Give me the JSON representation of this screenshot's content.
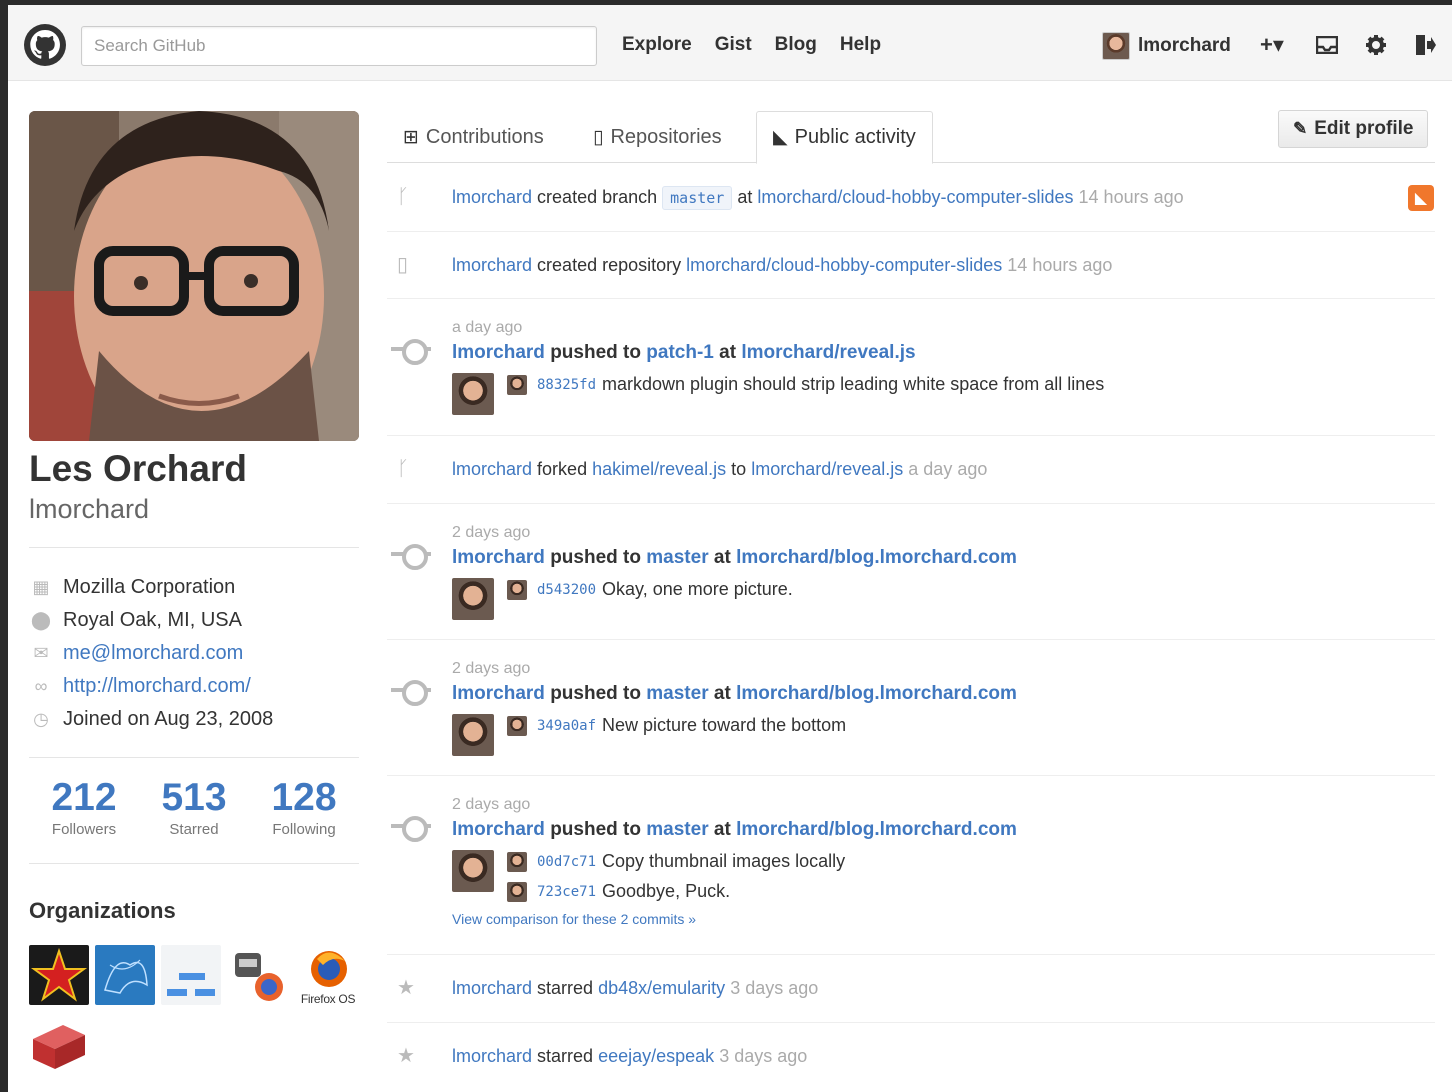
{
  "header": {
    "search_placeholder": "Search GitHub",
    "nav": [
      "Explore",
      "Gist",
      "Blog",
      "Help"
    ],
    "username": "lmorchard",
    "icons": [
      "plus-dropdown-icon",
      "inbox-icon",
      "gear-icon",
      "sign-out-icon"
    ],
    "plus_glyph": "+▾"
  },
  "profile": {
    "full_name": "Les Orchard",
    "login": "lmorchard",
    "company": "Mozilla Corporation",
    "location": "Royal Oak, MI, USA",
    "email": "me@lmorchard.com",
    "website": "http://lmorchard.com/",
    "joined": "Joined on Aug 23, 2008",
    "stats": [
      {
        "value": "212",
        "label": "Followers"
      },
      {
        "value": "513",
        "label": "Starred"
      },
      {
        "value": "128",
        "label": "Following"
      }
    ],
    "organizations_title": "Organizations",
    "firefox_os_label": "Firefox OS"
  },
  "tabs": {
    "contributions": "Contributions",
    "repositories": "Repositories",
    "public_activity": "Public activity"
  },
  "edit_profile": "Edit profile",
  "feed": {
    "item1": {
      "user": "lmorchard",
      "action": "created branch",
      "branch": "master",
      "at": "at",
      "repo": "lmorchard/cloud-hobby-computer-slides",
      "time": "14 hours ago"
    },
    "item2": {
      "user": "lmorchard",
      "action": "created repository",
      "repo": "lmorchard/cloud-hobby-computer-slides",
      "time": "14 hours ago"
    },
    "item3": {
      "time": "a day ago",
      "user": "lmorchard",
      "pushed": "pushed to",
      "branch": "patch-1",
      "at": "at",
      "repo": "lmorchard/reveal.js",
      "commits": [
        {
          "sha": "88325fd",
          "msg": "markdown plugin should strip leading white space from all lines"
        }
      ]
    },
    "item4": {
      "user": "lmorchard",
      "action": "forked",
      "source": "hakimel/reveal.js",
      "to": "to",
      "repo": "lmorchard/reveal.js",
      "time": "a day ago"
    },
    "item5": {
      "time": "2 days ago",
      "user": "lmorchard",
      "pushed": "pushed to",
      "branch": "master",
      "at": "at",
      "repo": "lmorchard/blog.lmorchard.com",
      "commits": [
        {
          "sha": "d543200",
          "msg": "Okay, one more picture."
        }
      ]
    },
    "item6": {
      "time": "2 days ago",
      "user": "lmorchard",
      "pushed": "pushed to",
      "branch": "master",
      "at": "at",
      "repo": "lmorchard/blog.lmorchard.com",
      "commits": [
        {
          "sha": "349a0af",
          "msg": "New picture toward the bottom"
        }
      ]
    },
    "item7": {
      "time": "2 days ago",
      "user": "lmorchard",
      "pushed": "pushed to",
      "branch": "master",
      "at": "at",
      "repo": "lmorchard/blog.lmorchard.com",
      "commits": [
        {
          "sha": "00d7c71",
          "msg": "Copy thumbnail images locally"
        },
        {
          "sha": "723ce71",
          "msg": "Goodbye, Puck."
        }
      ],
      "compare": "View comparison for these 2 commits »"
    },
    "item8": {
      "user": "lmorchard",
      "action": "starred",
      "repo": "db48x/emularity",
      "time": "3 days ago"
    },
    "item9": {
      "user": "lmorchard",
      "action": "starred",
      "repo": "eeejay/espeak",
      "time": "3 days ago"
    }
  },
  "colors": {
    "link": "#4078c0",
    "rss": "#f0772c",
    "muted": "#aaaaaa"
  }
}
